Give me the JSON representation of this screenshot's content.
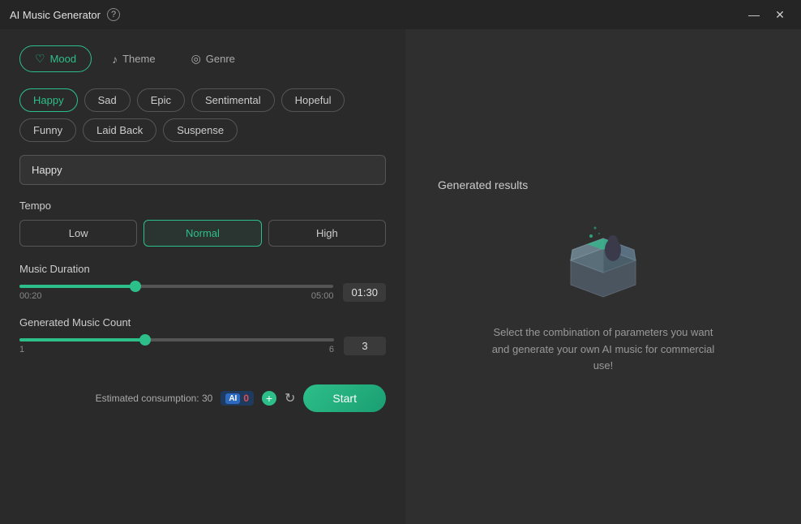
{
  "titlebar": {
    "title": "AI Music Generator",
    "help": "?",
    "minimize": "—",
    "close": "✕"
  },
  "tabs": [
    {
      "id": "mood",
      "label": "Mood",
      "icon": "♡",
      "active": true
    },
    {
      "id": "theme",
      "label": "Theme",
      "icon": "♪",
      "active": false
    },
    {
      "id": "genre",
      "label": "Genre",
      "icon": "◎",
      "active": false
    }
  ],
  "moods": [
    {
      "label": "Happy",
      "active": true
    },
    {
      "label": "Sad",
      "active": false
    },
    {
      "label": "Epic",
      "active": false
    },
    {
      "label": "Sentimental",
      "active": false
    },
    {
      "label": "Hopeful",
      "active": false
    },
    {
      "label": "Funny",
      "active": false
    },
    {
      "label": "Laid Back",
      "active": false
    },
    {
      "label": "Suspense",
      "active": false
    }
  ],
  "mood_input": "Happy",
  "tempo": {
    "label": "Tempo",
    "options": [
      {
        "label": "Low",
        "active": false
      },
      {
        "label": "Normal",
        "active": true
      },
      {
        "label": "High",
        "active": false
      }
    ]
  },
  "music_duration": {
    "label": "Music Duration",
    "min_label": "00:20",
    "max_label": "05:00",
    "value": "01:30",
    "fill_pct": 37,
    "thumb_pct": 37
  },
  "generated_music_count": {
    "label": "Generated Music Count",
    "min_label": "1",
    "max_label": "6",
    "value": "3",
    "fill_pct": 40,
    "thumb_pct": 40
  },
  "bottom": {
    "consumption_label": "Estimated consumption: 30",
    "ai_label": "AI",
    "credit_count": "0",
    "start_label": "Start"
  },
  "right_panel": {
    "title": "Generated results",
    "description": "Select the combination of parameters you want and generate your own AI music for commercial use!"
  }
}
